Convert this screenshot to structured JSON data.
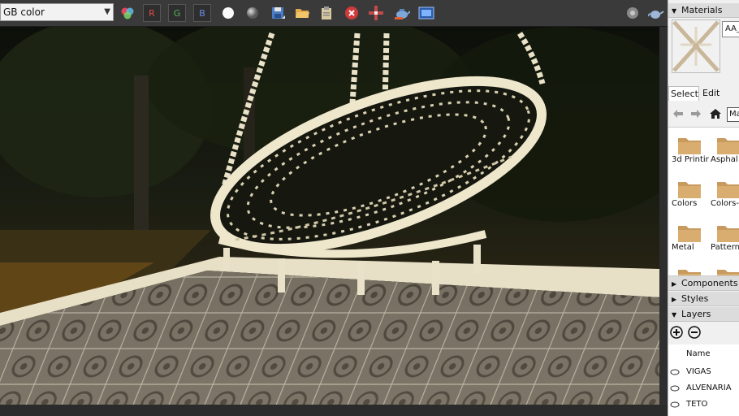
{
  "toolbar": {
    "channel_select": "GB color",
    "channel_r": "R",
    "channel_g": "G",
    "channel_b": "B"
  },
  "colors": {
    "channel_r": "#e04a4a",
    "channel_g": "#58b058",
    "channel_b": "#6a8ee6",
    "folder": "#c99a5e",
    "panel_bg": "#f0f0f0"
  },
  "icons": [
    "rgb-circles-icon",
    "sphere-white-icon",
    "sphere-grey-icon",
    "save-icon",
    "open-folder-icon",
    "clipboard-icon",
    "stop-icon",
    "compass-icon",
    "render-teapot-icon",
    "frame-buffer-icon",
    "settings-icon",
    "teapot-icon"
  ],
  "panel": {
    "materials_header": "Materials",
    "material_name": "AA_",
    "tab_select": "Select",
    "tab_edit": "Edit",
    "library_field": "Ma",
    "library_items": [
      "3d Printir",
      "Asphal",
      "Colors",
      "Colors-",
      "Metal",
      "Pattern",
      "",
      ""
    ],
    "components_header": "Components",
    "styles_header": "Styles",
    "layers_header": "Layers",
    "layers_name_header": "Name",
    "layers": [
      "VIGAS",
      "ALVENARIA",
      "TETO"
    ]
  }
}
